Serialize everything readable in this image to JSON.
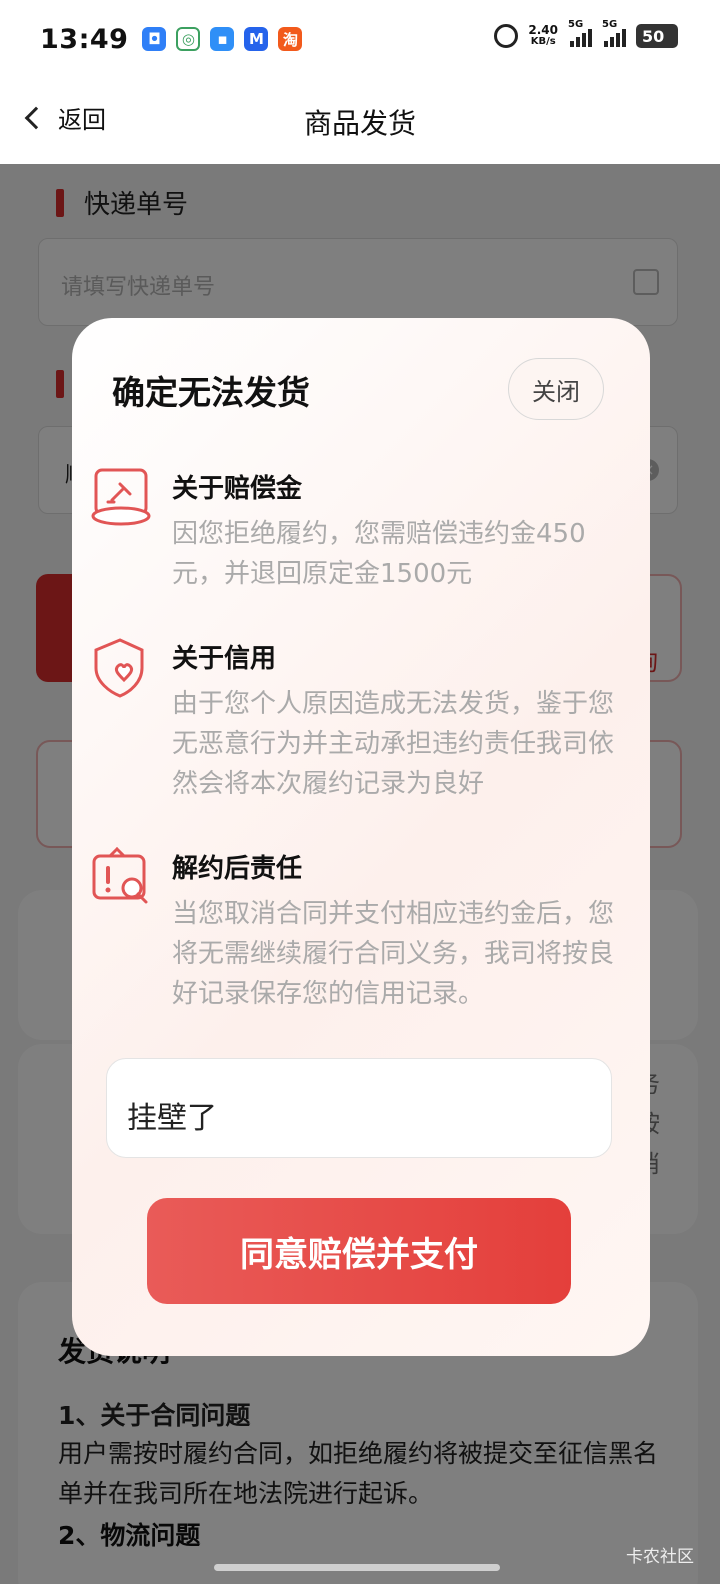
{
  "status_bar": {
    "time": "13:49",
    "net_speed": "2.40",
    "net_unit": "KB/s",
    "signal1": "5G",
    "signal2": "5G",
    "battery": "50",
    "notif_taobao_char": "淘"
  },
  "nav": {
    "back_label": "返回",
    "title": "商品发货"
  },
  "background": {
    "tracking_label": "快递单号",
    "tracking_placeholder": "请填写快递单号",
    "second_input_char": "顺",
    "query_char": "询",
    "side_text": "务\n按\n消",
    "notes_title": "发货说明",
    "notes_item1_title": "1、关于合同问题",
    "notes_item1_body": "用户需按时履约合同，如拒绝履约将被提交至征信黑名单并在我司所在地法院进行起诉。",
    "notes_item2_title": "2、物流问题"
  },
  "modal": {
    "title": "确定无法发货",
    "close_label": "关闭",
    "items": [
      {
        "icon": "gavel-icon",
        "title": "关于赔偿金",
        "desc": "因您拒绝履约，您需赔偿违约金450元，并退回原定金1500元"
      },
      {
        "icon": "shield-heart-icon",
        "title": "关于信用",
        "desc": "由于您个人原因造成无法发货，鉴于您无恶意行为并主动承担违约责任我司依然会将本次履约记录为良好"
      },
      {
        "icon": "warning-search-icon",
        "title": "解约后责任",
        "desc": "当您取消合同并支付相应违约金后，您将无需继续履行合同义务，我司将按良好记录保存您的信用记录。"
      }
    ],
    "reason_value": "挂壁了",
    "agree_label": "同意赔偿并支付"
  },
  "watermark": "卡农社区",
  "colors": {
    "accent": "#e43f3b",
    "icon_red": "#e15555",
    "desc_gray": "#aaaaaa"
  }
}
